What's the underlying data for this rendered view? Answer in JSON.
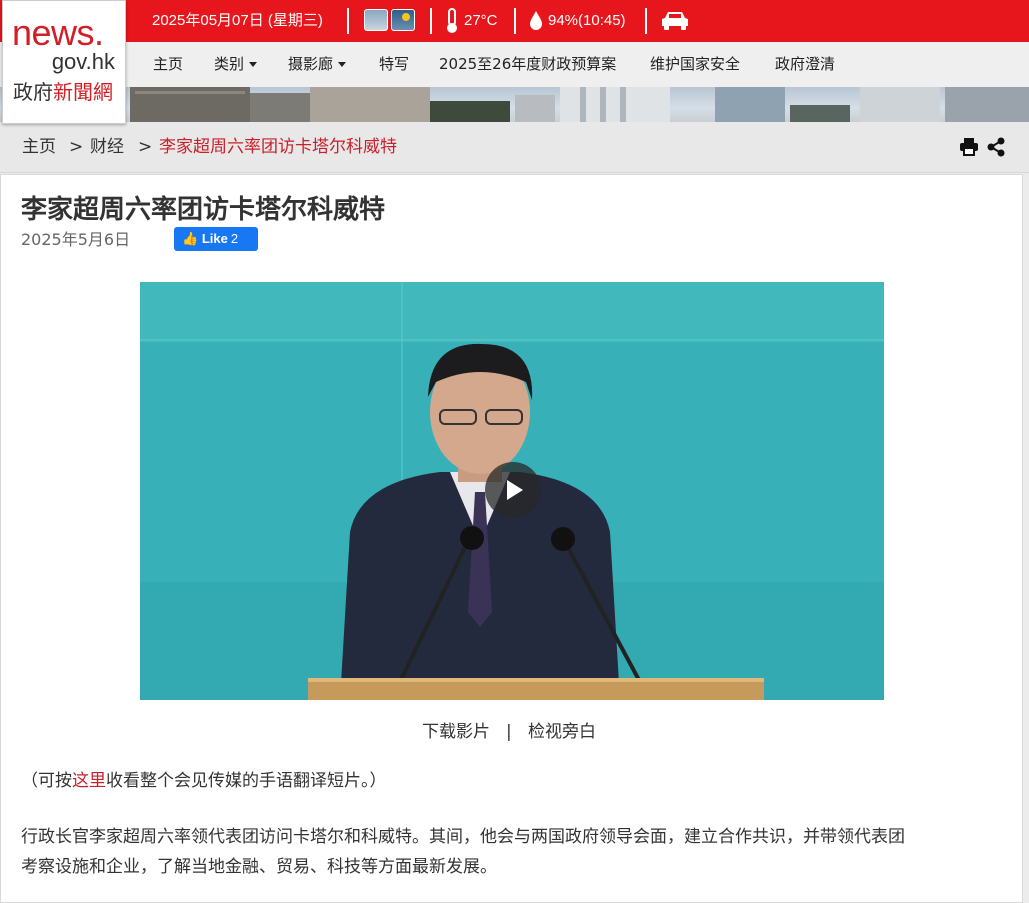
{
  "logo": {
    "line1": "news.",
    "line2": "gov.hk",
    "line3a": "政府",
    "line3b": "新聞網"
  },
  "topbar": {
    "date": "2025年05月07日 (星期三)",
    "temperature": "27°C",
    "humidity": "94%(10:45)",
    "icons": [
      "weather-cloudy-icon",
      "weather-sunny-rain-icon",
      "thermometer-icon",
      "droplet-icon",
      "car-icon"
    ]
  },
  "nav": {
    "items": [
      "主页",
      "类别",
      "摄影廊",
      "特写",
      "2025至26年度财政预算案",
      "维护国家安全",
      "政府澄清"
    ]
  },
  "breadcrumb": {
    "home": "主页",
    "sep": ">",
    "section": "财经",
    "current": "李家超周六率团访卡塔尔科威特"
  },
  "article": {
    "title": "李家超周六率团访卡塔尔科威特",
    "date": "2025年5月6日",
    "fb_like": "Like",
    "fb_count": "2",
    "download_video": "下载影片",
    "link_sep": "|",
    "view_narration": "检视旁白",
    "sign_note_pre": "（可按",
    "sign_note_link": "这里",
    "sign_note_post": "收看整个会见传媒的手语翻译短片。）",
    "body_line1": "行政长官李家超周六率领代表团访问卡塔尔和科威特。其间，他会与两国政府领导会面，建立合作共识，并带领代表团",
    "body_line2": "考察设施和企业，了解当地金融、贸易、科技等方面最新发展。"
  },
  "colors": {
    "brand_red": "#e6161c",
    "link_red": "#c8202a",
    "facebook_blue": "#1877f2"
  }
}
